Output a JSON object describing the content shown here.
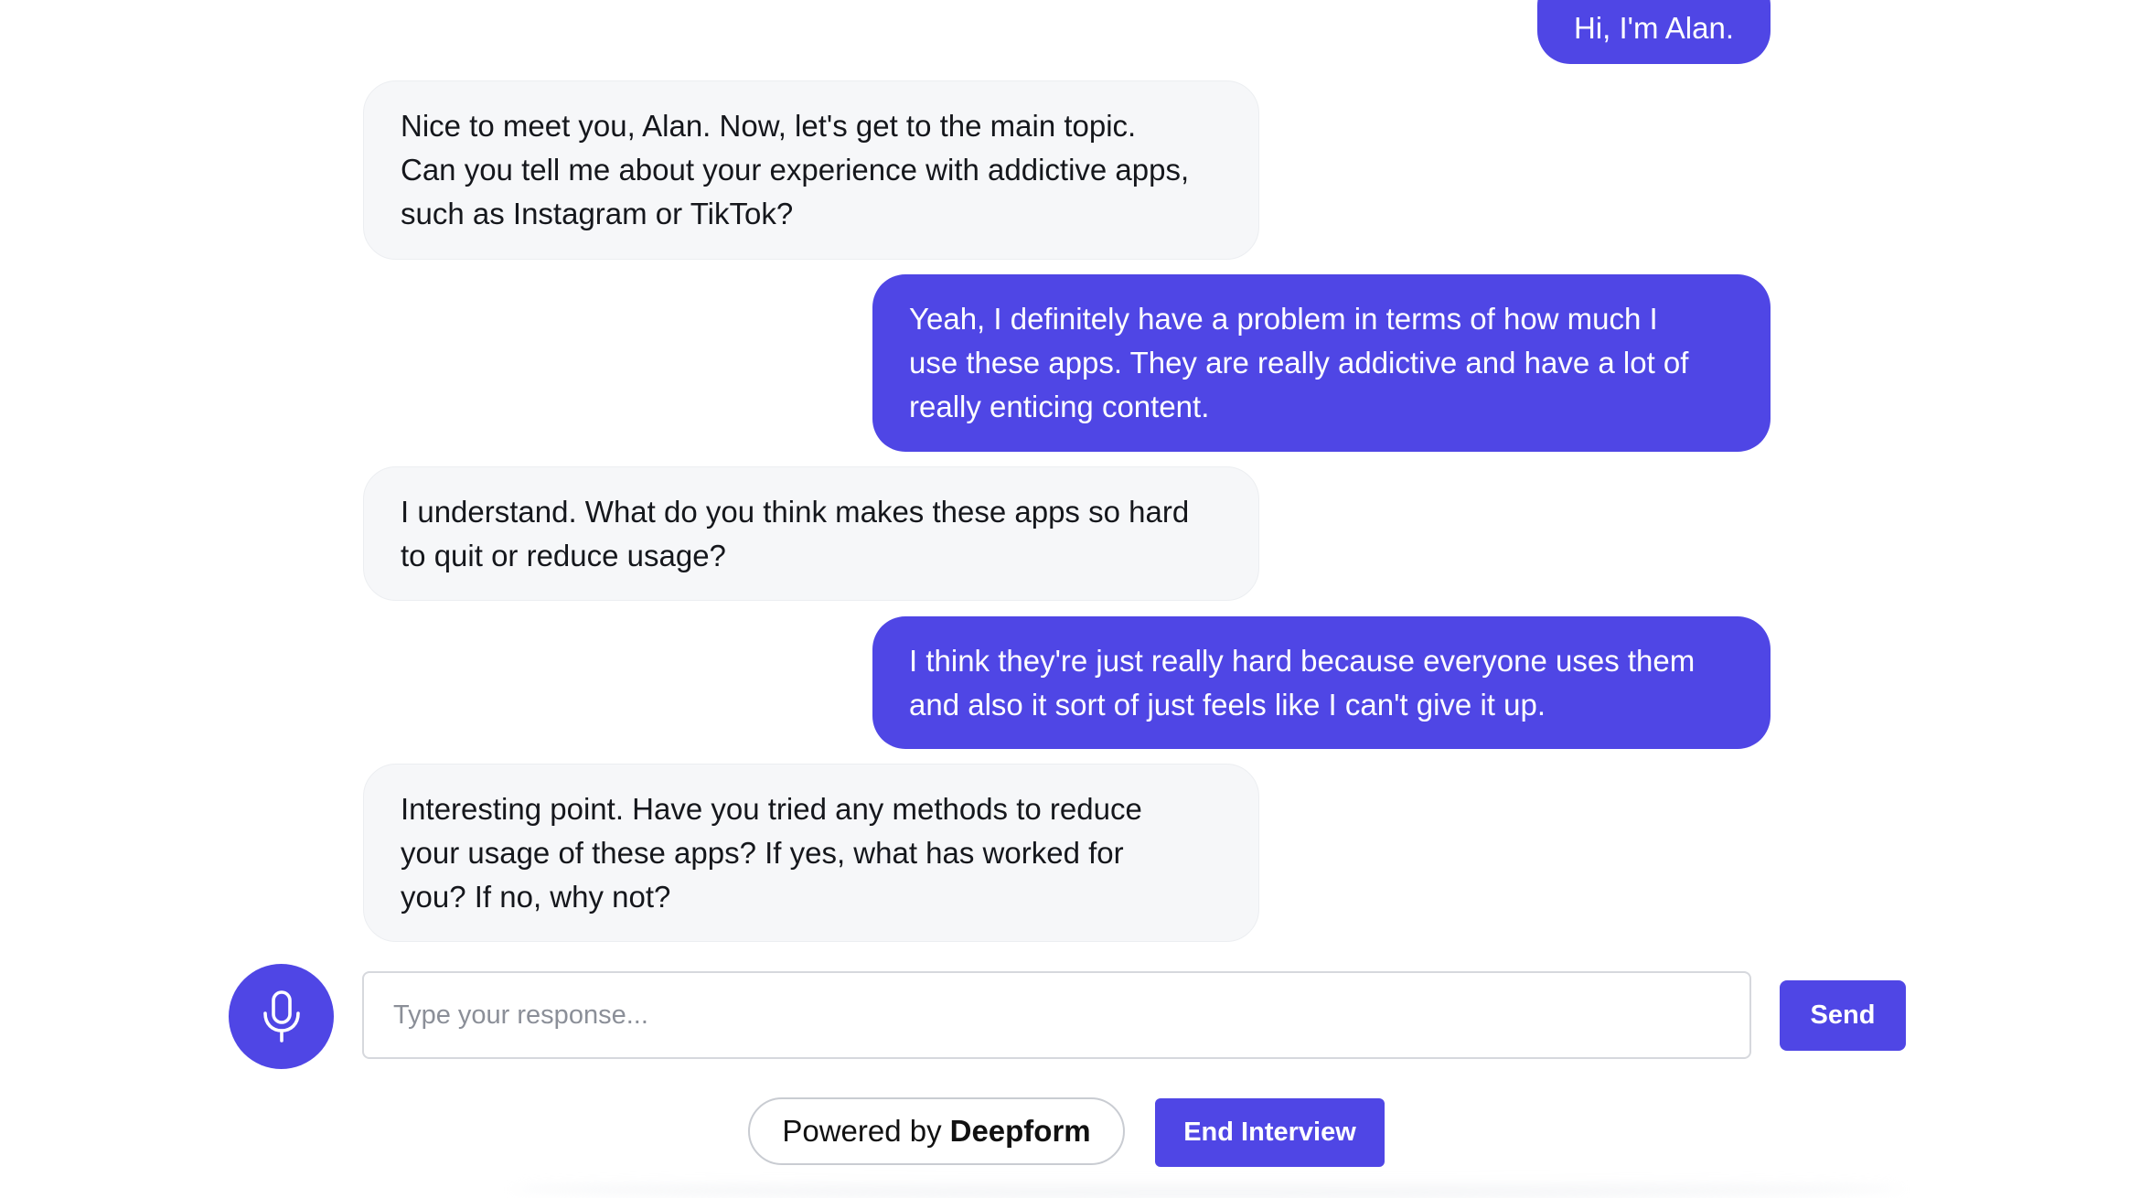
{
  "messages": [
    {
      "role": "user",
      "text": "Hi, I'm Alan."
    },
    {
      "role": "bot",
      "lines": [
        "Nice to meet you, Alan. Now, let's get to the main topic.",
        "Can you tell me about your experience with addictive apps,",
        "such as Instagram or TikTok?"
      ]
    },
    {
      "role": "user",
      "lines": [
        "Yeah, I definitely have a problem in terms of how much I",
        "use these apps. They are really addictive and have a lot of",
        "really enticing content."
      ]
    },
    {
      "role": "bot",
      "lines": [
        "I understand. What do you think makes these apps so hard",
        "to quit or reduce usage?"
      ]
    },
    {
      "role": "user",
      "lines": [
        "I think they're just really hard because everyone uses them",
        "and also it sort of just feels like I can't give it up."
      ]
    },
    {
      "role": "bot",
      "lines": [
        "Interesting point. Have you tried any methods to reduce",
        "your usage of these apps? If yes, what has worked for",
        "you? If no, why not?"
      ]
    }
  ],
  "composer": {
    "placeholder": "Type your response...",
    "value": "",
    "send_label": "Send",
    "mic_icon": "microphone-icon"
  },
  "footer": {
    "powered_prefix": "Powered by",
    "powered_brand": "Deepform",
    "end_label": "End Interview"
  },
  "colors": {
    "accent": "#4f46e5",
    "bot_bubble": "#f6f7f9",
    "text": "#15171c",
    "placeholder": "#8b8f98"
  }
}
